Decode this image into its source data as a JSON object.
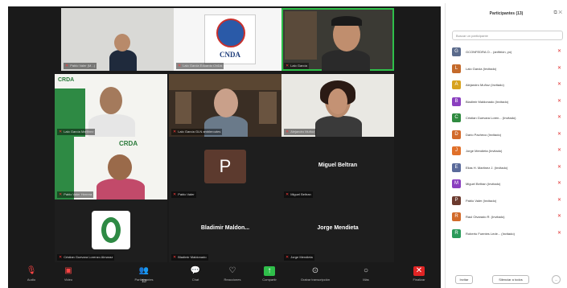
{
  "panel": {
    "title": "Participantes (13)",
    "search_placeholder": "Buscar un participante",
    "participants": [
      {
        "name": "GCONFEDRA O... (anfitrión, yo)",
        "color": "#5b6b8c",
        "initial": "G"
      },
      {
        "name": "Lalo Garcia (Invitado)",
        "color": "#c46a2b",
        "initial": "L"
      },
      {
        "name": "Alejandro Muñoz (Invitado)",
        "color": "#d7a21e",
        "initial": "A"
      },
      {
        "name": "Bladimir Maldonado (Invitado)",
        "color": "#8a3fbf",
        "initial": "B"
      },
      {
        "name": "Cristian Guevara Loren... (Invitado)",
        "color": "#2f8a3f",
        "initial": "C"
      },
      {
        "name": "Dario Pacheco (Invitado)",
        "color": "#d26a2a",
        "initial": "D"
      },
      {
        "name": "Jorge Mendieta (Invitado)",
        "color": "#e0702a",
        "initial": "J"
      },
      {
        "name": "Elias H. Martinez J. (Invitado)",
        "color": "#5a6a9a",
        "initial": "E"
      },
      {
        "name": "Miguel Beltran (Invitado)",
        "color": "#8a3fbf",
        "initial": "M"
      },
      {
        "name": "Pablo Valer (Invitado)",
        "color": "#6b3a2e",
        "initial": "P"
      },
      {
        "name": "Raul Olvarado R. (Invitado)",
        "color": "#d26a2a",
        "initial": "R"
      },
      {
        "name": "Roberto Fuentes Lede... (Invitado)",
        "color": "#2a9a5a",
        "initial": "R"
      }
    ],
    "invite_label": "Invitar",
    "mute_all_label": "Silenciar a todos"
  },
  "tiles": {
    "t1_name": "Pablo Valer (M...)",
    "t2_name": "Lalo Garcia Eduardo CNDA",
    "t3_name": "Lalo García",
    "t4_name": "Lalo García Martinez",
    "t5_name": "Lalo García GLN ambleroutes",
    "t6_name": "Alejandro Muñoz",
    "t7_name": "Pablo Valer Herrera",
    "t8_big": "P",
    "t8_name": "Pablo Valer",
    "t9_big": "Miguel Beltran",
    "t9_name": "Miguel Beltran",
    "t10_name": "Cristian Guevara Lorenzo Almaraz",
    "t11_big": "Bladimir Maldon...",
    "t11_name": "Bladimir Maldonado",
    "t12_big": "Jorge Mendieta",
    "t12_name": "Jorge Mendieta",
    "cnda_logo": "CNDA",
    "crda_logo": "CRDA"
  },
  "toolbar": {
    "audio": "Audio",
    "video": "Video",
    "participants": "Participantes",
    "participants_count": "13",
    "chat": "Chat",
    "reactions": "Reacciones",
    "share": "Compartir",
    "record": "Grabar transcripción",
    "more": "Más",
    "leave": "Finalizar"
  }
}
